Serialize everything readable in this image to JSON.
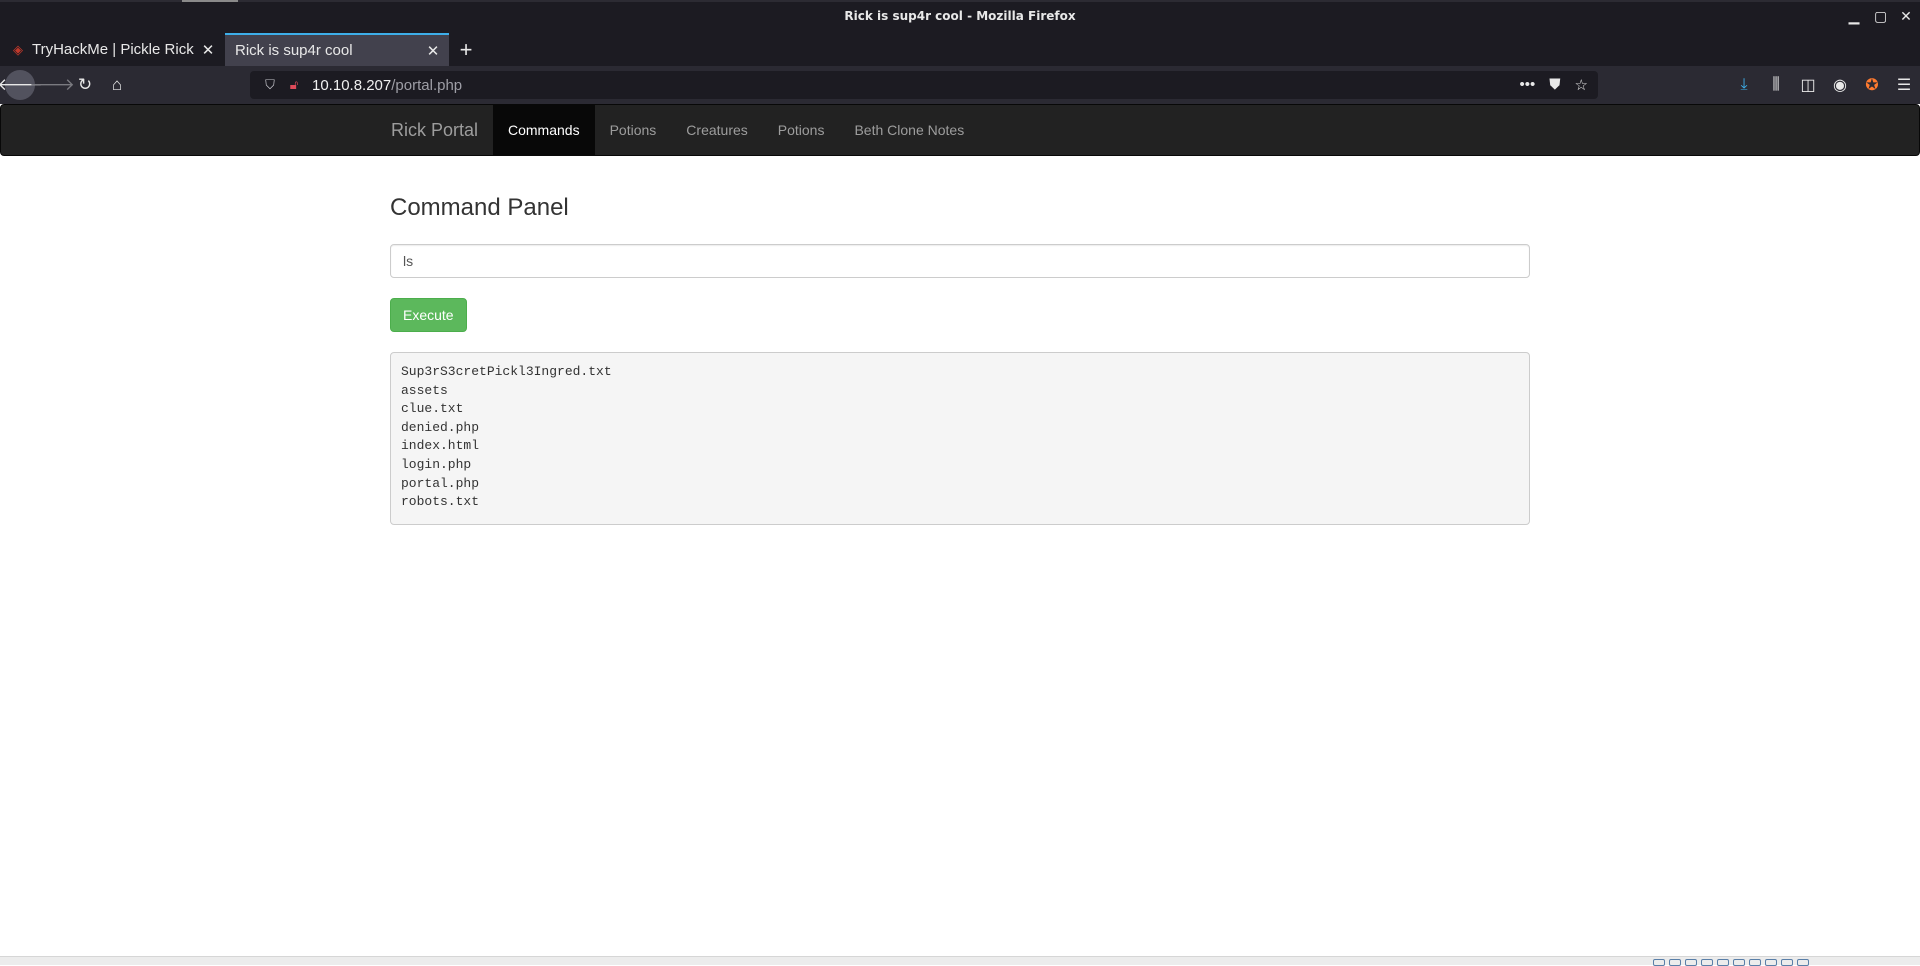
{
  "window": {
    "title": "Rick is sup4r cool - Mozilla Firefox",
    "controls": {
      "minimize": "▁",
      "maximize": "▢",
      "close": "✕"
    }
  },
  "tabs": [
    {
      "label": "TryHackMe | Pickle Rick",
      "active": false
    },
    {
      "label": "Rick is sup4r cool",
      "active": true
    }
  ],
  "toolbar": {
    "url_host": "10.10.8.207",
    "url_path": "/portal.php"
  },
  "site": {
    "brand": "Rick Portal",
    "nav": [
      {
        "label": "Commands",
        "active": true
      },
      {
        "label": "Potions",
        "active": false
      },
      {
        "label": "Creatures",
        "active": false
      },
      {
        "label": "Potions",
        "active": false
      },
      {
        "label": "Beth Clone Notes",
        "active": false
      }
    ]
  },
  "panel": {
    "title": "Command Panel",
    "command_value": "ls",
    "execute_label": "Execute",
    "output_lines": [
      "Sup3rS3cretPickl3Ingred.txt",
      "assets",
      "clue.txt",
      "denied.php",
      "index.html",
      "login.php",
      "portal.php",
      "robots.txt"
    ]
  },
  "colors": {
    "execute_button": "#5cb85c",
    "site_nav_bg": "#222222",
    "active_tab_accent": "#3daee9"
  }
}
